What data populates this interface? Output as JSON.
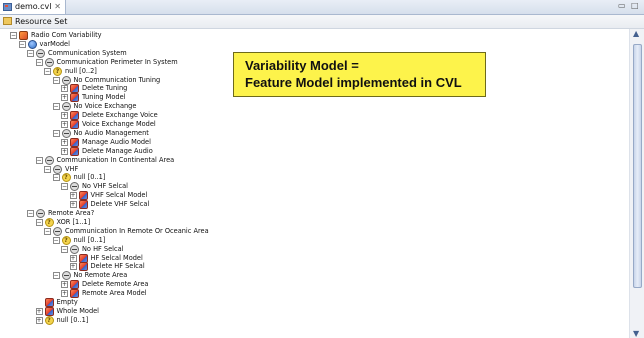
{
  "editor": {
    "tab_label": "demo.cvl",
    "tab_close": "✕",
    "minimize": "▭",
    "maximize": "□"
  },
  "ribbon": {
    "label": "Resource Set"
  },
  "callout": {
    "line1": "Variability Model =",
    "line2": "Feature Model implemented in CVL"
  },
  "tree": [
    {
      "label": "Radio Com Variability",
      "icon": "radio"
    },
    {
      "label": "varModel",
      "icon": "var"
    },
    {
      "label": "Communication System",
      "icon": "feat"
    },
    {
      "label": "Communication Perimeter In System",
      "icon": "feat"
    },
    {
      "label": "null [0..2]",
      "icon": "null"
    },
    {
      "label": "No Communication Tuning",
      "icon": "feat"
    },
    {
      "label": "Delete Tuning",
      "icon": "model"
    },
    {
      "label": "Tuning Model",
      "icon": "model"
    },
    {
      "label": "No Voice Exchange",
      "icon": "feat"
    },
    {
      "label": "Delete Exchange Voice",
      "icon": "model"
    },
    {
      "label": "Voice Exchange Model",
      "icon": "model"
    },
    {
      "label": "No Audio Management",
      "icon": "feat"
    },
    {
      "label": "Manage Audio Model",
      "icon": "model"
    },
    {
      "label": "Delete Manage Audio",
      "icon": "model"
    },
    {
      "label": "Communication In Continental Area",
      "icon": "feat"
    },
    {
      "label": "VHF",
      "icon": "feat"
    },
    {
      "label": "null [0..1]",
      "icon": "null"
    },
    {
      "label": "No VHF Selcal",
      "icon": "feat"
    },
    {
      "label": "VHF Selcal Model",
      "icon": "model"
    },
    {
      "label": "Delete VHF Selcal",
      "icon": "model"
    },
    {
      "label": "Remote Area?",
      "icon": "feat"
    },
    {
      "label": "XOR [1..1]",
      "icon": "null"
    },
    {
      "label": "Communication In Remote Or Oceanic Area",
      "icon": "feat"
    },
    {
      "label": "null [0..1]",
      "icon": "null"
    },
    {
      "label": "No HF Selcal",
      "icon": "feat"
    },
    {
      "label": "HF Selcal Model",
      "icon": "model"
    },
    {
      "label": "Delete HF Selcal",
      "icon": "model"
    },
    {
      "label": "No Remote Area",
      "icon": "feat"
    },
    {
      "label": "Delete Remote Area",
      "icon": "model"
    },
    {
      "label": "Remote Area Model",
      "icon": "model"
    },
    {
      "label": "Empty",
      "icon": "model"
    },
    {
      "label": "Whole Model",
      "icon": "model"
    },
    {
      "label": "null [0..1]",
      "icon": "null"
    }
  ],
  "icons": {
    "feat": "feature-icon",
    "null": "choice-null-icon",
    "var": "variability-model-icon",
    "model": "model-fragment-icon",
    "radio": "package-icon"
  },
  "scroll": {
    "up": "▲",
    "down": "▼"
  }
}
